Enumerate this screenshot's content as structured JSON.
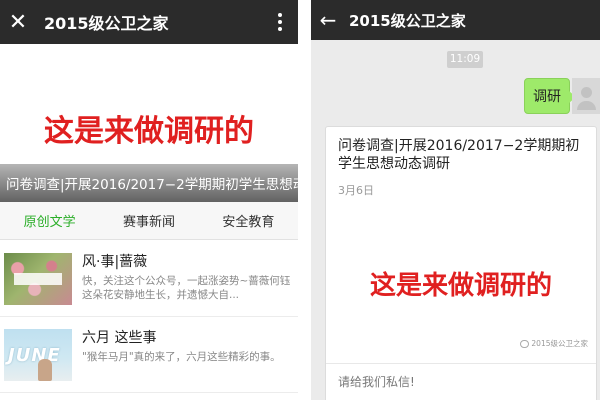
{
  "left": {
    "title": "2015级公卫之家",
    "close_icon": "close-icon",
    "more_icon": "more-vertical-icon",
    "banner": {
      "headline": "这是来做调研的",
      "caption": "问卷调查|开展2016/2017−2学期期初学生思想动"
    },
    "tabs": [
      {
        "label": "原创文学",
        "active": true
      },
      {
        "label": "赛事新闻",
        "active": false
      },
      {
        "label": "安全教育",
        "active": false
      }
    ],
    "articles": [
      {
        "title": "风·事|蔷薇",
        "desc": "快，关注这个公众号，一起涨姿势~蔷薇何钰 这朵花安静地生长，并遗憾大自..."
      },
      {
        "title": "六月 这些事",
        "desc": "\"猴年马月\"真的来了，六月这些精彩的事。"
      }
    ],
    "thumb2_text": "JUNE"
  },
  "right": {
    "title": "2015级公卫之家",
    "back_icon": "back-arrow-icon",
    "timestamp": "11:09",
    "my_message": "调研",
    "card": {
      "title": "问卷调查|开展2016/2017−2学期期初学生思想动态调研",
      "date": "3月6日",
      "headline": "这是来做调研的",
      "watermark": "2015级公卫之家",
      "footer": "请给我们私信!"
    }
  },
  "colors": {
    "titlebar": "#2b2b2b",
    "accent_green": "#2aae28",
    "headline_red": "#e02020",
    "bubble_green": "#9eea6a"
  }
}
